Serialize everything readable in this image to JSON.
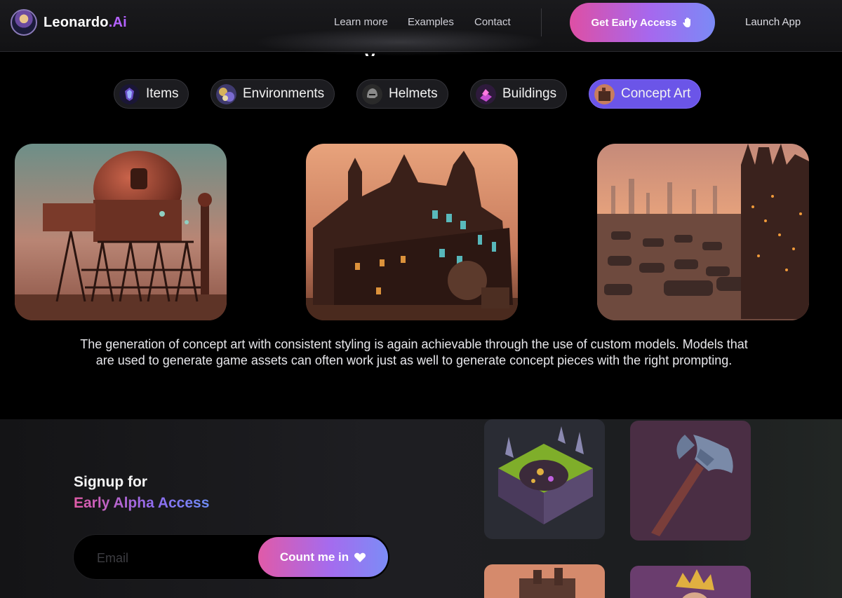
{
  "nav": {
    "logo_name": "Leonardo",
    "logo_dot": ".",
    "logo_ai": "Ai",
    "links": [
      "Learn more",
      "Examples",
      "Contact"
    ],
    "cta_label": "Get Early Access",
    "cta_icon": "waving-hand-icon",
    "launch_label": "Launch App"
  },
  "heading_remnant": "y",
  "tabs": [
    {
      "label": "Items",
      "icon": "items-thumb-icon",
      "active": false
    },
    {
      "label": "Environments",
      "icon": "environments-thumb-icon",
      "active": false
    },
    {
      "label": "Helmets",
      "icon": "helmets-thumb-icon",
      "active": false
    },
    {
      "label": "Buildings",
      "icon": "buildings-thumb-icon",
      "active": false
    },
    {
      "label": "Concept Art",
      "icon": "concept-art-thumb-icon",
      "active": true
    }
  ],
  "description": "The generation of concept art with consistent styling is again achievable through the use of custom models. Models that are used to generate game assets can often work just as well to generate concept pieces with the right prompting.",
  "signup": {
    "title": "Signup for",
    "subtitle": "Early Alpha Access",
    "email_placeholder": "Email",
    "email_value": "",
    "button_label": "Count me in",
    "button_icon": "heart-icon"
  },
  "colors": {
    "accent_pink": "#de4fa4",
    "accent_purple": "#a668ee",
    "accent_blue": "#7b8af6",
    "active_tab": "#6b55e8",
    "background": "#000000"
  }
}
